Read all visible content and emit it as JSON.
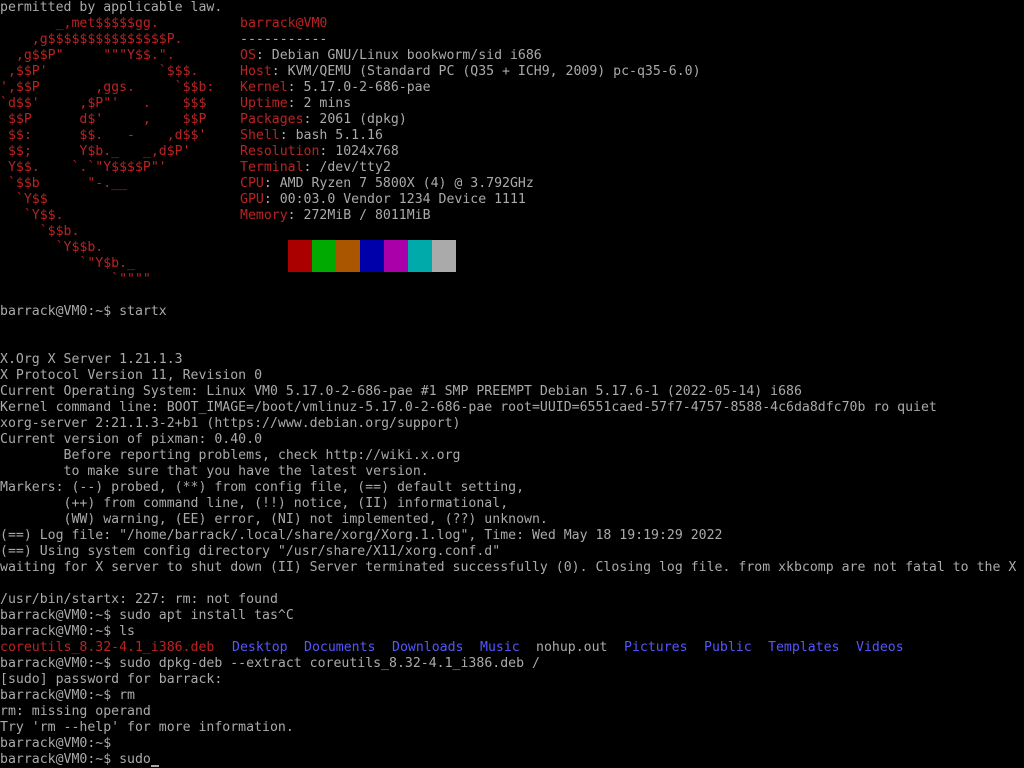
{
  "screen": {
    "top_line": "permitted by applicable law.",
    "logo": [
      "       _,met$$$$$gg.",
      "    ,g$$$$$$$$$$$$$$$P.",
      "  ,g$$P\"     \"\"\"Y$$.\".",
      " ,$$P'              `$$$.",
      "',$$P       ,ggs.     `$$b:",
      "`d$$'     ,$P\"'   .    $$$",
      " $$P      d$'     ,    $$P",
      " $$:      $$.   -    ,d$$'",
      " $$;      Y$b._   _,d$P'",
      " Y$$.    `.`\"Y$$$$P\"'",
      " `$$b      \"-.__",
      "  `Y$$",
      "   `Y$$.",
      "     `$$b.",
      "       `Y$$b.",
      "          `\"Y$b._",
      "              `\"\"\"\""
    ],
    "fetch": {
      "user_host": "barrack@VM0",
      "separator": "-----------",
      "rows": [
        {
          "label": "OS",
          "value": "Debian GNU/Linux bookworm/sid i686"
        },
        {
          "label": "Host",
          "value": "KVM/QEMU (Standard PC (Q35 + ICH9, 2009) pc-q35-6.0)"
        },
        {
          "label": "Kernel",
          "value": "5.17.0-2-686-pae"
        },
        {
          "label": "Uptime",
          "value": "2 mins"
        },
        {
          "label": "Packages",
          "value": "2061 (dpkg)"
        },
        {
          "label": "Shell",
          "value": "bash 5.1.16"
        },
        {
          "label": "Resolution",
          "value": "1024x768"
        },
        {
          "label": "Terminal",
          "value": "/dev/tty2"
        },
        {
          "label": "CPU",
          "value": "AMD Ryzen 7 5800X (4) @ 3.792GHz"
        },
        {
          "label": "GPU",
          "value": "00:03.0 Vendor 1234 Device 1111"
        },
        {
          "label": "Memory",
          "value": "272MiB / 8011MiB"
        }
      ],
      "palette": [
        "#000000",
        "#aa0000",
        "#00aa00",
        "#aa5500",
        "#0000aa",
        "#aa00aa",
        "#00aaaa",
        "#aaaaaa"
      ]
    },
    "prompt": "barrack@VM0:~$ ",
    "startx_cmd": "startx",
    "xorg_lines": [
      "X.Org X Server 1.21.1.3",
      "X Protocol Version 11, Revision 0",
      "Current Operating System: Linux VM0 5.17.0-2-686-pae #1 SMP PREEMPT Debian 5.17.6-1 (2022-05-14) i686",
      "Kernel command line: BOOT_IMAGE=/boot/vmlinuz-5.17.0-2-686-pae root=UUID=6551caed-57f7-4757-8588-4c6da8dfc70b ro quiet",
      "xorg-server 2:21.1.3-2+b1 (https://www.debian.org/support)",
      "Current version of pixman: 0.40.0",
      "        Before reporting problems, check http://wiki.x.org",
      "        to make sure that you have the latest version.",
      "Markers: (--) probed, (**) from config file, (==) default setting,",
      "        (++) from command line, (!!) notice, (II) informational,",
      "        (WW) warning, (EE) error, (NI) not implemented, (??) unknown.",
      "(==) Log file: \"/home/barrack/.local/share/xorg/Xorg.1.log\", Time: Wed May 18 19:19:29 2022",
      "(==) Using system config directory \"/usr/share/X11/xorg.conf.d\"",
      "waiting for X server to shut down (II) Server terminated successfully (0). Closing log file. from xkbcomp are not fatal to the X"
    ],
    "startx_error": "/usr/bin/startx: 227: rm: not found",
    "cmd_apt": "sudo apt install tas^C",
    "cmd_ls": "ls",
    "ls_output": [
      {
        "name": "coreutils_8.32-4.1_i386.deb",
        "kind": "archive"
      },
      {
        "name": "Desktop",
        "kind": "dir"
      },
      {
        "name": "Documents",
        "kind": "dir"
      },
      {
        "name": "Downloads",
        "kind": "dir"
      },
      {
        "name": "Music",
        "kind": "dir"
      },
      {
        "name": "nohup.out",
        "kind": "file"
      },
      {
        "name": "Pictures",
        "kind": "dir"
      },
      {
        "name": "Public",
        "kind": "dir"
      },
      {
        "name": "Templates",
        "kind": "dir"
      },
      {
        "name": "Videos",
        "kind": "dir"
      }
    ],
    "cmd_dpkg": "sudo dpkg-deb --extract coreutils_8.32-4.1_i386.deb /",
    "sudo_prompt": "[sudo] password for barrack:",
    "cmd_rm": "rm",
    "rm_err1": "rm: missing operand",
    "rm_err2": "Try 'rm --help' for more information.",
    "cmd_current": "sudo",
    "colors": {
      "text": "#aaaaaa",
      "accent_red": "#bb2222",
      "dir_blue": "#5555ff",
      "background": "#000000"
    }
  }
}
